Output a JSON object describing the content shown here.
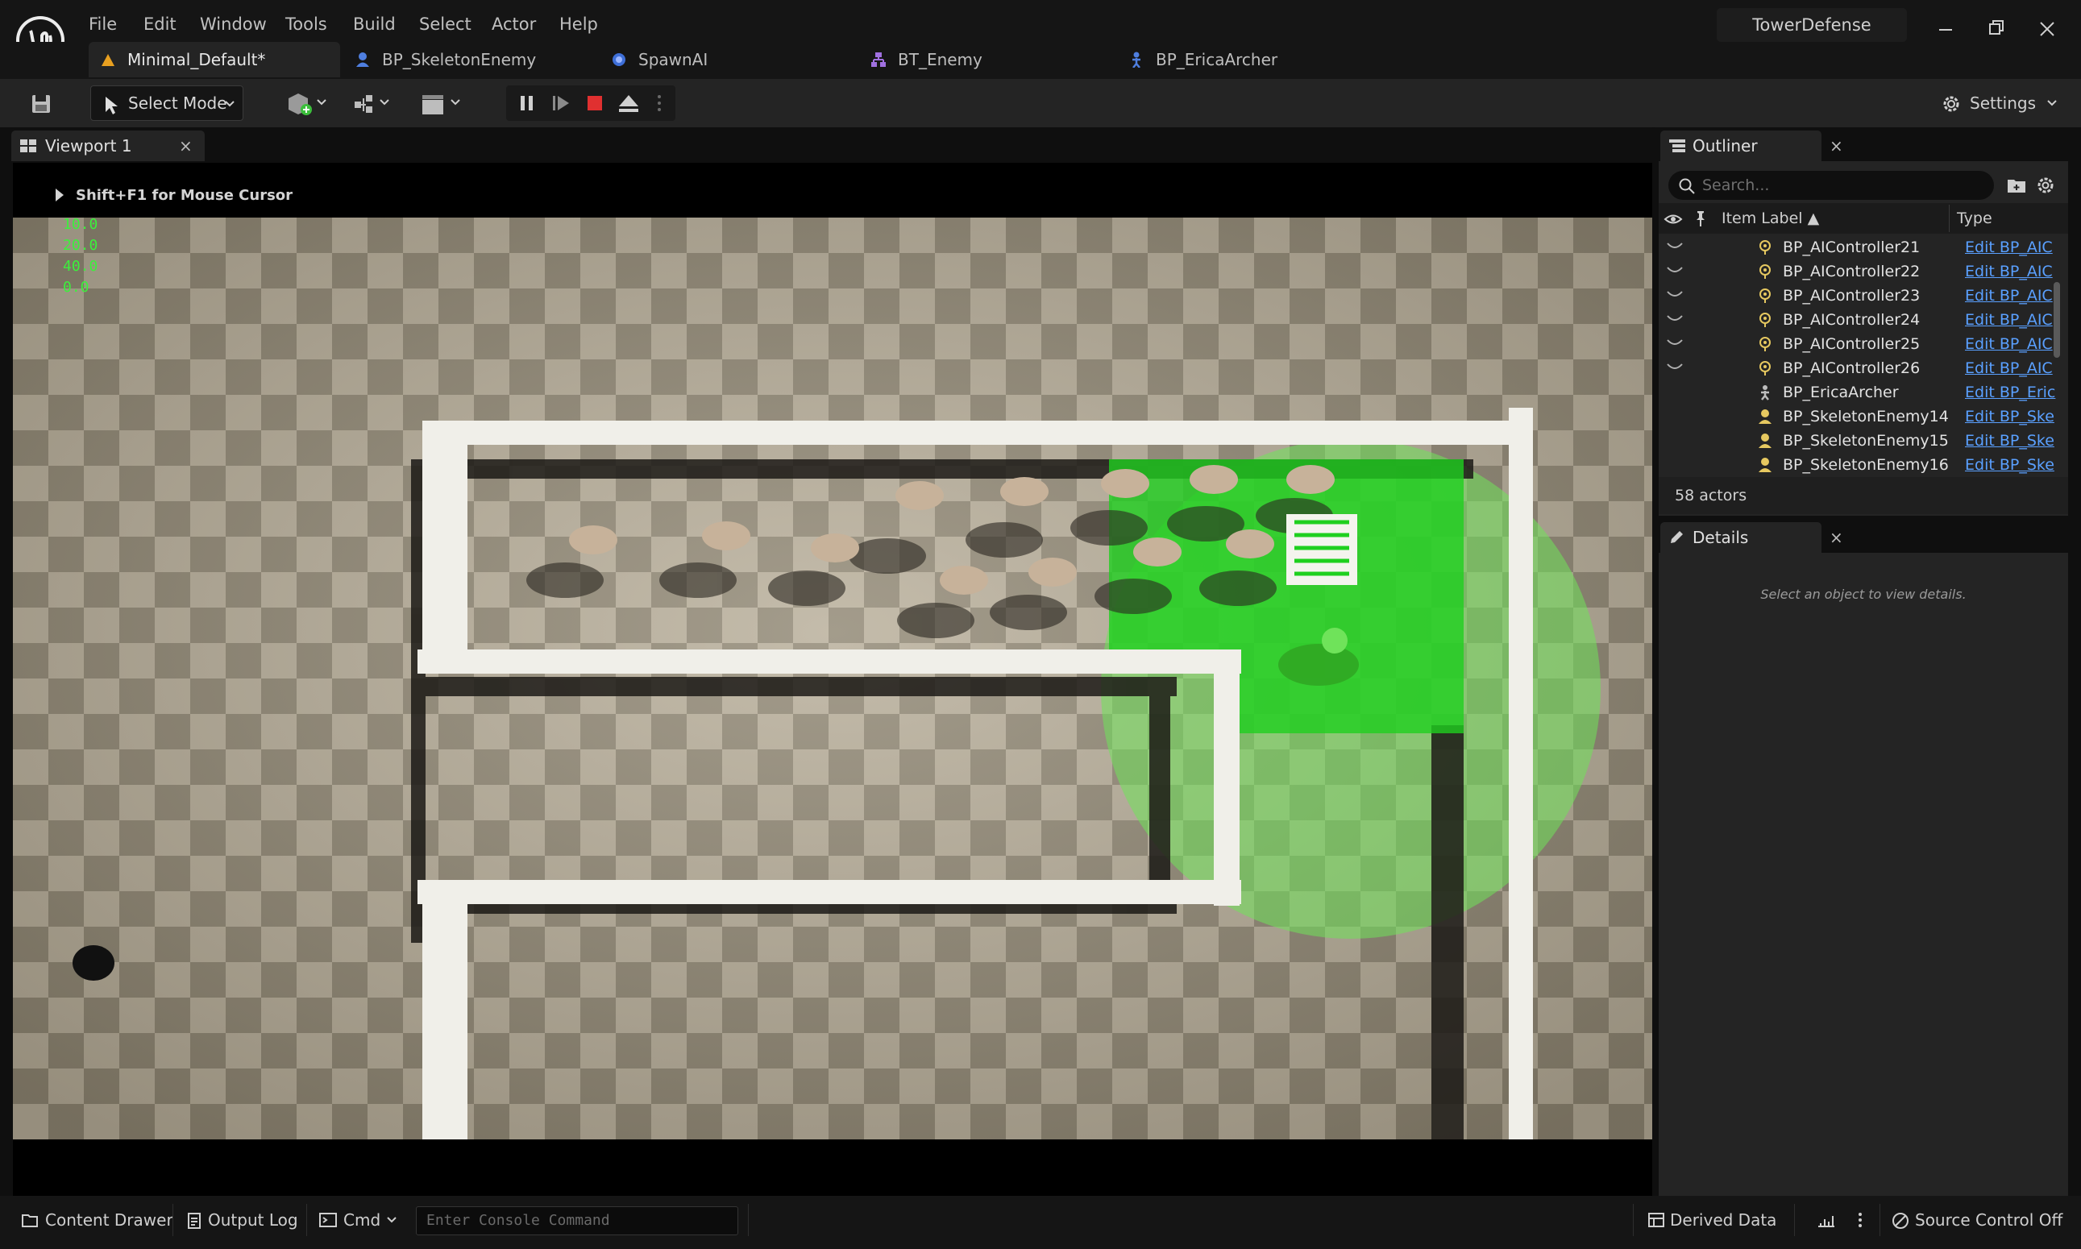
{
  "app": {
    "project_name": "TowerDefense",
    "menu": [
      "File",
      "Edit",
      "Window",
      "Tools",
      "Build",
      "Select",
      "Actor",
      "Help"
    ]
  },
  "doc_tabs": [
    {
      "label": "Minimal_Default*",
      "icon": "level-icon",
      "active": true
    },
    {
      "label": "BP_SkeletonEnemy",
      "icon": "pawn-blueprint-icon",
      "active": false
    },
    {
      "label": "SpawnAI",
      "icon": "blueprint-icon",
      "active": false
    },
    {
      "label": "BT_Enemy",
      "icon": "behavior-tree-icon",
      "active": false
    },
    {
      "label": "BP_EricaArcher",
      "icon": "character-blueprint-icon",
      "active": false
    }
  ],
  "toolbar": {
    "select_mode": "Select Mode",
    "settings": "Settings"
  },
  "viewport": {
    "tab_label": "Viewport 1",
    "close": "×",
    "mouse_hint": "Shift+F1 for Mouse Cursor",
    "stats": [
      "10.0",
      "20.0",
      "40.0",
      "0.0"
    ]
  },
  "outliner": {
    "tab_label": "Outliner",
    "close": "×",
    "search_placeholder": "Search...",
    "col_label": "Item Label ▲",
    "col_type": "Type",
    "rows": [
      {
        "name": "BP_AIController21",
        "type": "Edit BP_AIC",
        "icon": "ai-controller-icon",
        "eye": true
      },
      {
        "name": "BP_AIController22",
        "type": "Edit BP_AIC",
        "icon": "ai-controller-icon",
        "eye": true
      },
      {
        "name": "BP_AIController23",
        "type": "Edit BP_AIC",
        "icon": "ai-controller-icon",
        "eye": true
      },
      {
        "name": "BP_AIController24",
        "type": "Edit BP_AIC",
        "icon": "ai-controller-icon",
        "eye": true
      },
      {
        "name": "BP_AIController25",
        "type": "Edit BP_AIC",
        "icon": "ai-controller-icon",
        "eye": true
      },
      {
        "name": "BP_AIController26",
        "type": "Edit BP_AIC",
        "icon": "ai-controller-icon",
        "eye": true
      },
      {
        "name": "BP_EricaArcher",
        "type": "Edit BP_Eric",
        "icon": "character-icon",
        "eye": false
      },
      {
        "name": "BP_SkeletonEnemy14",
        "type": "Edit BP_Ske",
        "icon": "pawn-icon",
        "eye": false
      },
      {
        "name": "BP_SkeletonEnemy15",
        "type": "Edit BP_Ske",
        "icon": "pawn-icon",
        "eye": false
      },
      {
        "name": "BP_SkeletonEnemy16",
        "type": "Edit BP_Ske",
        "icon": "pawn-icon",
        "eye": false
      }
    ],
    "actor_count": "58 actors"
  },
  "details": {
    "tab_label": "Details",
    "close": "×",
    "empty_message": "Select an object to view details."
  },
  "statusbar": {
    "content_drawer": "Content Drawer",
    "output_log": "Output Log",
    "cmd": "Cmd",
    "console_placeholder": "Enter Console Command",
    "derived_data": "Derived Data",
    "source_control": "Source Control Off"
  },
  "colors": {
    "accent_green": "#1fd01f",
    "link_blue": "#5aa0ff",
    "stop_red": "#e03030",
    "level_orange": "#e8a020"
  }
}
